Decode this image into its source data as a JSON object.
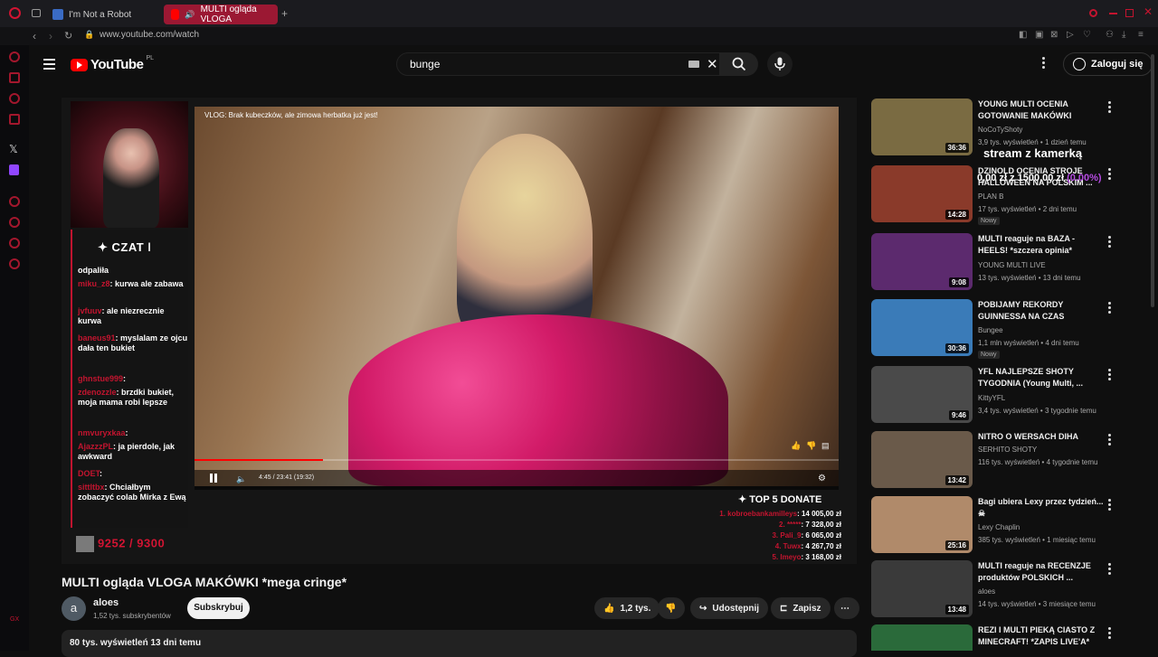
{
  "browser": {
    "tabs": [
      {
        "label": "I'm Not a Robot"
      },
      {
        "label": "MULTI ogląda VLOGA"
      }
    ],
    "new_tab": "+",
    "url": "www.youtube.com/watch"
  },
  "header": {
    "logo": "YouTube",
    "region": "PL",
    "search_value": "bunge",
    "signin_label": "Zaloguj się"
  },
  "player": {
    "vlog_title": "VLOG: Brak kubeczków, ale zimowa herbatka już jest!",
    "timecode": "4:45 / 23:41 (19:32)",
    "progress": 0.2,
    "chat_header": "✦ CZAT ǀ",
    "chat": [
      {
        "user": "",
        "text": "odpaliła"
      },
      {
        "user": "miku_z8",
        "text": ": kurwa ale zabawa"
      },
      {
        "user": "jvfuuv",
        "text": ": ale niezrecznie kurwa"
      },
      {
        "user": "baneus91",
        "text": ": myslalam ze ojcu dała ten bukiet"
      },
      {
        "user": "ghnstue999",
        "text": ":"
      },
      {
        "user": "zdenozzle",
        "text": ": brzdki bukiet, moja mama robi lepsze"
      },
      {
        "user": "nmvuryxkaa",
        "text": ":"
      },
      {
        "user": "AjazzzPL",
        "text": ": ja pierdole, jak awkward"
      },
      {
        "user": "DOET",
        "text": ":"
      },
      {
        "user": "sittltbx",
        "text": ": Chciałbym zobaczyć colab Mirka z Ewą"
      }
    ],
    "counter": "9252 / 9300",
    "donate_header": "✦ TOP 5 DONATE",
    "donates": [
      {
        "name": "1. kobroebankamilleys",
        "amount": ": 14 005,00 zł"
      },
      {
        "name": "2. *****",
        "amount": ": 7 328,00 zł"
      },
      {
        "name": "3. Pali_9",
        "amount": ": 6 065,00 zł"
      },
      {
        "name": "4. Tuwx",
        "amount": ": 4 267,70 zł"
      },
      {
        "name": "5. Imeyo",
        "amount": ": 3 168,00 zł"
      }
    ]
  },
  "video": {
    "title": "MULTI ogląda VLOGA MAKÓWKI *mega cringe*",
    "channel": "aloes",
    "avatar_letter": "a",
    "subscribers": "1,52 tys. subskrybentów",
    "subscribe_label": "Subskrybuj",
    "likes": "1,2 tys.",
    "share_label": "Udostępnij",
    "save_label": "Zapisz",
    "views_date": "80 tys. wyświetleń  13 dni temu"
  },
  "overlay": {
    "stream_text": "stream z kamerką",
    "goal_text": "0,00 zł z 1500,00 zł",
    "goal_pct": "(0.00%)"
  },
  "recommendations": [
    {
      "title": "YOUNG MULTI OCENIA GOTOWANIE MAKÓWKI",
      "channel": "NoCoTyShoty",
      "meta": "3,9 tys. wyświetleń • 1 dzień temu",
      "duration": "36:36",
      "badge": "",
      "color": "#7a6b42"
    },
    {
      "title": "DZINOLD OCENIA STROJE HALLOWEEN NA POLSKIM ...",
      "channel": "PLAN B",
      "meta": "17 tys. wyświetleń • 2 dni temu",
      "duration": "14:28",
      "badge": "Nowy",
      "color": "#8a3a2a"
    },
    {
      "title": "MULTI reaguje na BAZA - HEELS! *szczera opinia*",
      "channel": "YOUNG MULTI LIVE",
      "meta": "13 tys. wyświetleń • 13 dni temu",
      "duration": "9:08",
      "badge": "",
      "color": "#5c2a6e"
    },
    {
      "title": "POBIJAMY REKORDY GUINNESSA NA CZAS",
      "channel": "Bungee",
      "meta": "1,1 mln wyświetleń • 4 dni temu",
      "duration": "30:36",
      "badge": "Nowy",
      "color": "#3a7bb8"
    },
    {
      "title": "YFL NAJLEPSZE SHOTY TYGODNIA (Young Multi, ...",
      "channel": "KittyYFL",
      "meta": "3,4 tys. wyświetleń • 3 tygodnie temu",
      "duration": "9:46",
      "badge": "",
      "color": "#4a4a4a"
    },
    {
      "title": "NITRO O WERSACH DIHA",
      "channel": "SERHITO SHOTY",
      "meta": "116 tys. wyświetleń • 4 tygodnie temu",
      "duration": "13:42",
      "badge": "",
      "color": "#6a5a4a"
    },
    {
      "title": "Bagi ubiera Lexy przez tydzień... ☠",
      "channel": "Lexy Chaplin",
      "meta": "385 tys. wyświetleń • 1 miesiąc temu",
      "duration": "25:16",
      "badge": "",
      "color": "#b08a6a"
    },
    {
      "title": "MULTI reaguje na RECENZJE produktów POLSKICH ...",
      "channel": "aloes",
      "meta": "14 tys. wyświetleń • 3 miesiące temu",
      "duration": "13:48",
      "badge": "",
      "color": "#3a3a3a"
    },
    {
      "title": "REZI I MULTI PIEKĄ CIASTO Z MINECRAFT! *ZAPIS LIVE'A*",
      "channel": "",
      "meta": "",
      "duration": "",
      "badge": "",
      "color": "#2a6a3a"
    }
  ]
}
